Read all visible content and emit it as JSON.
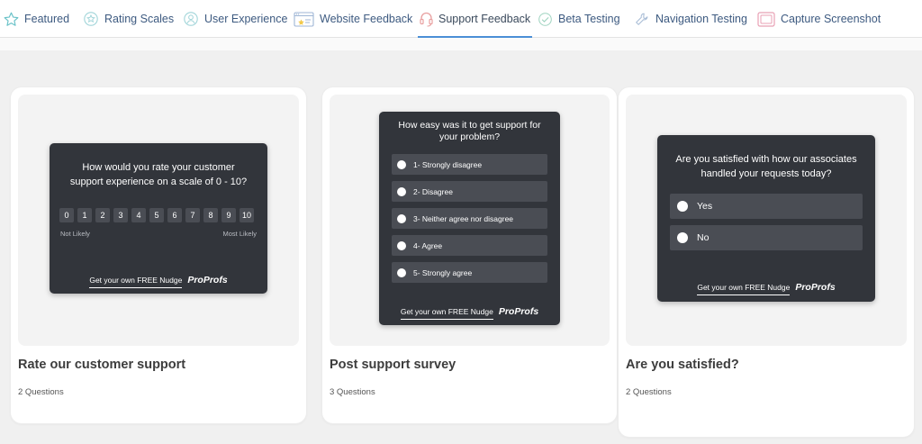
{
  "tabs": [
    {
      "label": "Featured",
      "icon": "star-icon"
    },
    {
      "label": "Rating Scales",
      "icon": "rating-scales-icon"
    },
    {
      "label": "User Experience",
      "icon": "user-experience-icon"
    },
    {
      "label": "Website Feedback",
      "icon": "website-feedback-icon"
    },
    {
      "label": "Support Feedback",
      "icon": "headset-icon",
      "active": true
    },
    {
      "label": "Beta Testing",
      "icon": "check-circle-icon"
    },
    {
      "label": "Navigation Testing",
      "icon": "wrench-icon"
    },
    {
      "label": "Capture Screenshot",
      "icon": "screenshot-icon"
    }
  ],
  "colors": {
    "accent": "#4b8fd6",
    "tab_text": "#3d5a80",
    "widget_bg": "#32353b",
    "option_bg": "#4a4d54",
    "page_bg": "#f0f0f0"
  },
  "footer": {
    "link": "Get your own FREE Nudge",
    "brand": "ProProfs"
  },
  "cards": [
    {
      "title": "Rate our customer support",
      "subtitle": "2 Questions",
      "widget": {
        "question": "How would you rate your customer support experience on a scale of 0 - 10?",
        "scale": [
          "0",
          "1",
          "2",
          "3",
          "4",
          "5",
          "6",
          "7",
          "8",
          "9",
          "10"
        ],
        "low_label": "Not Likely",
        "high_label": "Most Likely"
      }
    },
    {
      "title": "Post support survey",
      "subtitle": "3 Questions",
      "widget": {
        "question": "How easy was it to get support for your problem?",
        "options": [
          "1- Strongly disagree",
          "2- Disagree",
          "3- Neither agree nor disagree",
          "4- Agree",
          "5- Strongly agree"
        ]
      }
    },
    {
      "title": "Are you satisfied?",
      "subtitle": "2 Questions",
      "widget": {
        "question": "Are you satisfied with how our associates handled your requests today?",
        "options": [
          "Yes",
          "No"
        ]
      }
    }
  ]
}
